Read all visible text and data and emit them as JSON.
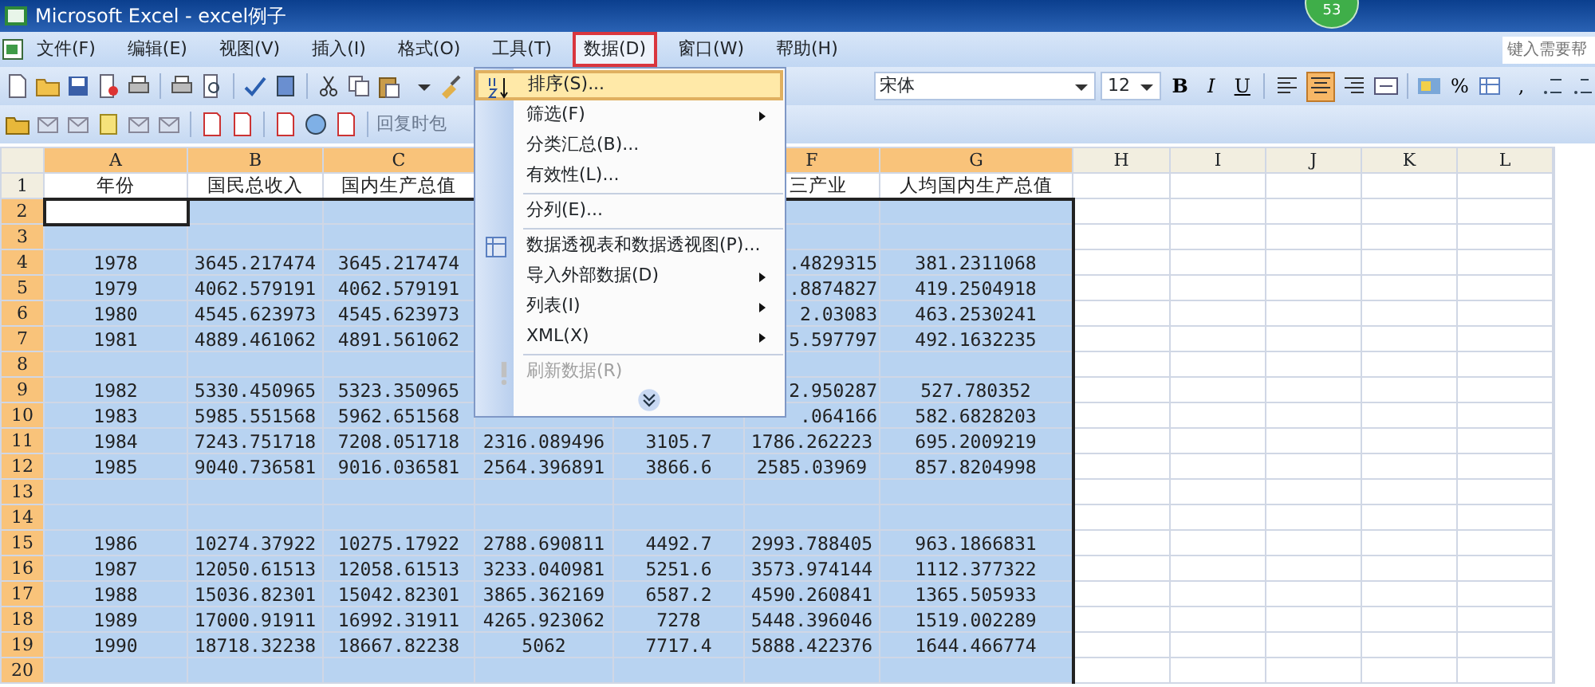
{
  "window": {
    "title": "Microsoft Excel - excel例子",
    "badge": "53"
  },
  "menu_bar": [
    {
      "label": "文件(F)",
      "selected": false,
      "annotated": false
    },
    {
      "label": "编辑(E)",
      "selected": false,
      "annotated": false
    },
    {
      "label": "视图(V)",
      "selected": false,
      "annotated": false
    },
    {
      "label": "插入(I)",
      "selected": false,
      "annotated": false
    },
    {
      "label": "格式(O)",
      "selected": false,
      "annotated": false
    },
    {
      "label": "工具(T)",
      "selected": false,
      "annotated": false
    },
    {
      "label": "数据(D)",
      "selected": true,
      "annotated": true
    },
    {
      "label": "窗口(W)",
      "selected": false,
      "annotated": false
    },
    {
      "label": "帮助(H)",
      "selected": false,
      "annotated": false
    }
  ],
  "help_box": {
    "placeholder": "键入需要帮"
  },
  "formatting_toolbar": {
    "font": "宋体",
    "size": "12",
    "styles": [
      "B",
      "I",
      "U"
    ],
    "alignment": [
      {
        "selected": false
      },
      {
        "selected": true
      },
      {
        "selected": false
      }
    ],
    "percent": "%",
    "comma": ","
  },
  "reviewing_toolbar": {
    "reply_text": "回复时包"
  },
  "columns": [
    {
      "label": "A",
      "selected": true
    },
    {
      "label": "B",
      "selected": true
    },
    {
      "label": "C",
      "selected": true
    },
    null,
    null,
    {
      "label": "F",
      "selected": true
    },
    {
      "label": "G",
      "selected": true
    },
    {
      "label": "H",
      "selected": false
    },
    {
      "label": "I",
      "selected": false
    },
    {
      "label": "J",
      "selected": false
    },
    {
      "label": "K",
      "selected": false
    },
    {
      "label": "L",
      "selected": false
    }
  ],
  "rows": [
    {
      "header": "1",
      "selected": false,
      "cells": [
        "年份",
        "国民总收入",
        "国内生产总值",
        null,
        null,
        "三产业",
        "人均国内生产总值"
      ]
    },
    {
      "header": "2",
      "selected": true,
      "active": true
    },
    {
      "header": "3",
      "selected": true
    },
    {
      "header": "4",
      "selected": true,
      "cells": [
        "1978",
        "3645.217474",
        "3645.217474",
        null,
        null,
        ".4829315",
        "381.2311068"
      ]
    },
    {
      "header": "5",
      "selected": true,
      "cells": [
        "1979",
        "4062.579191",
        "4062.579191",
        null,
        null,
        ".8874827",
        "419.2504918"
      ]
    },
    {
      "header": "6",
      "selected": true,
      "cells": [
        "1980",
        "4545.623973",
        "4545.623973",
        null,
        null,
        "2.03083",
        "463.2530241"
      ]
    },
    {
      "header": "7",
      "selected": true,
      "cells": [
        "1981",
        "4889.461062",
        "4891.561062",
        null,
        null,
        "5.597797",
        "492.1632235"
      ]
    },
    {
      "header": "8",
      "selected": true
    },
    {
      "header": "9",
      "selected": true,
      "cells": [
        "1982",
        "5330.450965",
        "5323.350965",
        null,
        null,
        "2.950287",
        "527.780352"
      ]
    },
    {
      "header": "10",
      "selected": true,
      "cells": [
        "1983",
        "5985.551568",
        "5962.651568",
        null,
        null,
        ".064166",
        "582.6828203"
      ]
    },
    {
      "header": "11",
      "selected": true,
      "cells": [
        "1984",
        "7243.751718",
        "7208.051718",
        "2316.089496",
        "3105.7",
        "1786.262223",
        "695.2009219"
      ]
    },
    {
      "header": "12",
      "selected": true,
      "cells": [
        "1985",
        "9040.736581",
        "9016.036581",
        "2564.396891",
        "3866.6",
        "2585.03969",
        "857.8204998"
      ]
    },
    {
      "header": "13",
      "selected": true
    },
    {
      "header": "14",
      "selected": true
    },
    {
      "header": "15",
      "selected": true,
      "cells": [
        "1986",
        "10274.37922",
        "10275.17922",
        "2788.690811",
        "4492.7",
        "2993.788405",
        "963.1866831"
      ]
    },
    {
      "header": "16",
      "selected": true,
      "cells": [
        "1987",
        "12050.61513",
        "12058.61513",
        "3233.040981",
        "5251.6",
        "3573.974144",
        "1112.377322"
      ]
    },
    {
      "header": "17",
      "selected": true,
      "cells": [
        "1988",
        "15036.82301",
        "15042.82301",
        "3865.362169",
        "6587.2",
        "4590.260841",
        "1365.505933"
      ]
    },
    {
      "header": "18",
      "selected": true,
      "cells": [
        "1989",
        "17000.91911",
        "16992.31911",
        "4265.923062",
        "7278",
        "5448.396046",
        "1519.002289"
      ]
    },
    {
      "header": "19",
      "selected": true,
      "cells": [
        "1990",
        "18718.32238",
        "18667.82238",
        "5062",
        "7717.4",
        "5888.422376",
        "1644.466774"
      ]
    },
    {
      "header": "20",
      "selected": true
    }
  ],
  "data_menu": [
    {
      "kind": "item",
      "label": "排序(S)...",
      "selected": true,
      "annotated": true,
      "submenu": false,
      "disabled": false
    },
    {
      "kind": "item",
      "label": "筛选(F)",
      "selected": false,
      "annotated": false,
      "submenu": true,
      "disabled": false
    },
    {
      "kind": "item",
      "label": "分类汇总(B)...",
      "selected": false,
      "annotated": false,
      "submenu": false,
      "disabled": false
    },
    {
      "kind": "item",
      "label": "有效性(L)...",
      "selected": false,
      "annotated": false,
      "submenu": false,
      "disabled": false
    },
    {
      "kind": "separator"
    },
    {
      "kind": "item",
      "label": "分列(E)...",
      "selected": false,
      "annotated": false,
      "submenu": false,
      "disabled": false
    },
    {
      "kind": "separator"
    },
    {
      "kind": "item",
      "label": "数据透视表和数据透视图(P)...",
      "selected": false,
      "annotated": false,
      "submenu": false,
      "disabled": false
    },
    {
      "kind": "item",
      "label": "导入外部数据(D)",
      "selected": false,
      "annotated": false,
      "submenu": true,
      "disabled": false
    },
    {
      "kind": "item",
      "label": "列表(I)",
      "selected": false,
      "annotated": false,
      "submenu": true,
      "disabled": false
    },
    {
      "kind": "item",
      "label": "XML(X)",
      "selected": false,
      "annotated": false,
      "submenu": true,
      "disabled": false
    },
    {
      "kind": "separator"
    },
    {
      "kind": "item",
      "label": "刷新数据(R)",
      "selected": false,
      "annotated": false,
      "submenu": false,
      "disabled": true
    },
    {
      "kind": "expand"
    }
  ]
}
